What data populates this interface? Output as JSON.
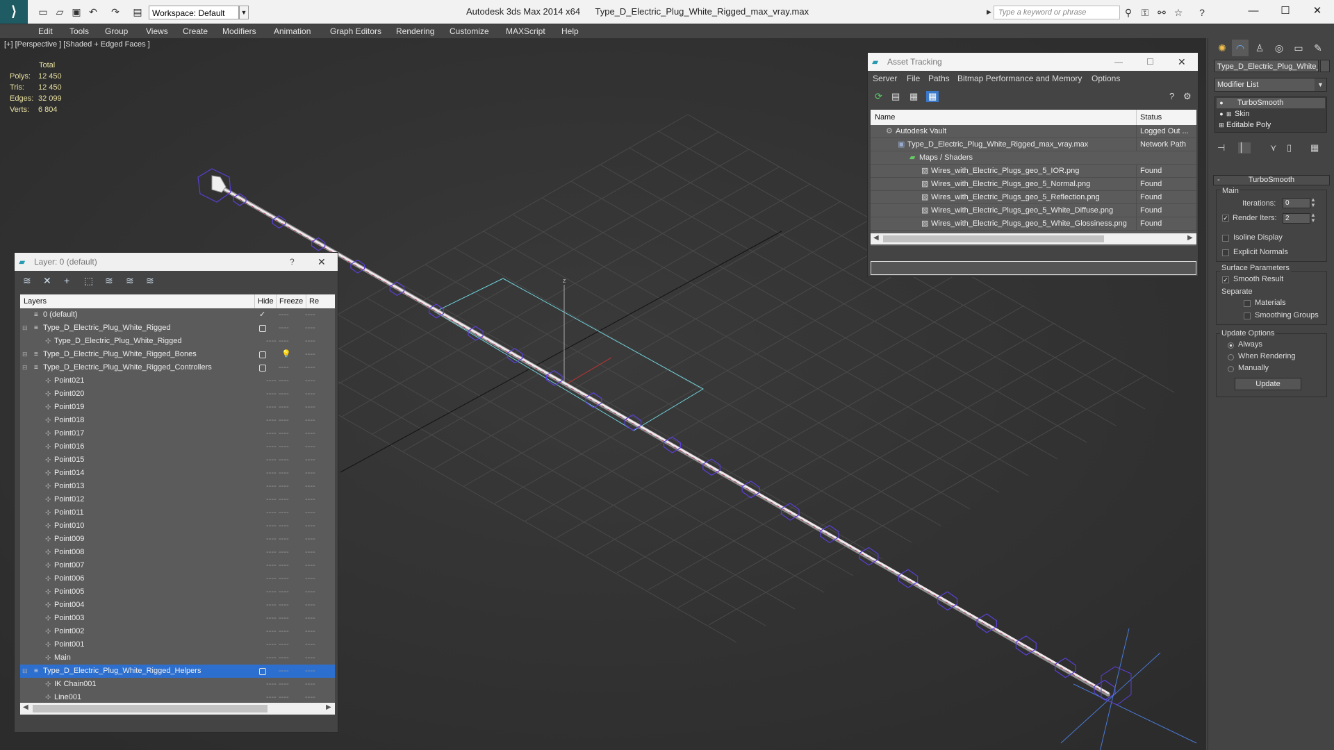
{
  "titlebar": {
    "workspace": "Workspace: Default",
    "app_name": "Autodesk 3ds Max  2014 x64",
    "file_name": "Type_D_Electric_Plug_White_Rigged_max_vray.max",
    "search_placeholder": "Type a keyword or phrase"
  },
  "menu": [
    "Edit",
    "Tools",
    "Group",
    "Views",
    "Create",
    "Modifiers",
    "Animation",
    "Graph Editors",
    "Rendering",
    "Customize",
    "MAXScript",
    "Help"
  ],
  "viewport": {
    "label": "[+] [Perspective ] [Shaded + Edged Faces ]",
    "stats": {
      "header": "Total",
      "rows": [
        {
          "label": "Polys:",
          "value": "12 450"
        },
        {
          "label": "Tris:",
          "value": "12 450"
        },
        {
          "label": "Edges:",
          "value": "32 099"
        },
        {
          "label": "Verts:",
          "value": "6 804"
        }
      ]
    },
    "axis_label": "z"
  },
  "layer_window": {
    "title": "Layer: 0 (default)",
    "help": "?",
    "columns": [
      "Layers",
      "Hide",
      "Freeze",
      "Re"
    ],
    "rows": [
      {
        "name": "0 (default)",
        "indent": 0,
        "kind": "layer",
        "current": true
      },
      {
        "name": "Type_D_Electric_Plug_White_Rigged",
        "indent": 0,
        "kind": "layer",
        "box": true
      },
      {
        "name": "Type_D_Electric_Plug_White_Rigged",
        "indent": 1,
        "kind": "object"
      },
      {
        "name": "Type_D_Electric_Plug_White_Rigged_Bones",
        "indent": 0,
        "kind": "layer",
        "box": true,
        "bulb": true
      },
      {
        "name": "Type_D_Electric_Plug_White_Rigged_Controllers",
        "indent": 0,
        "kind": "layer",
        "box": true
      },
      {
        "name": "Point021",
        "indent": 1,
        "kind": "object"
      },
      {
        "name": "Point020",
        "indent": 1,
        "kind": "object"
      },
      {
        "name": "Point019",
        "indent": 1,
        "kind": "object"
      },
      {
        "name": "Point018",
        "indent": 1,
        "kind": "object"
      },
      {
        "name": "Point017",
        "indent": 1,
        "kind": "object"
      },
      {
        "name": "Point016",
        "indent": 1,
        "kind": "object"
      },
      {
        "name": "Point015",
        "indent": 1,
        "kind": "object"
      },
      {
        "name": "Point014",
        "indent": 1,
        "kind": "object"
      },
      {
        "name": "Point013",
        "indent": 1,
        "kind": "object"
      },
      {
        "name": "Point012",
        "indent": 1,
        "kind": "object"
      },
      {
        "name": "Point011",
        "indent": 1,
        "kind": "object"
      },
      {
        "name": "Point010",
        "indent": 1,
        "kind": "object"
      },
      {
        "name": "Point009",
        "indent": 1,
        "kind": "object"
      },
      {
        "name": "Point008",
        "indent": 1,
        "kind": "object"
      },
      {
        "name": "Point007",
        "indent": 1,
        "kind": "object"
      },
      {
        "name": "Point006",
        "indent": 1,
        "kind": "object"
      },
      {
        "name": "Point005",
        "indent": 1,
        "kind": "object"
      },
      {
        "name": "Point004",
        "indent": 1,
        "kind": "object"
      },
      {
        "name": "Point003",
        "indent": 1,
        "kind": "object"
      },
      {
        "name": "Point002",
        "indent": 1,
        "kind": "object"
      },
      {
        "name": "Point001",
        "indent": 1,
        "kind": "object"
      },
      {
        "name": "Main",
        "indent": 1,
        "kind": "object"
      },
      {
        "name": "Type_D_Electric_Plug_White_Rigged_Helpers",
        "indent": 0,
        "kind": "layer",
        "box": true,
        "selected": true
      },
      {
        "name": "IK Chain001",
        "indent": 1,
        "kind": "object"
      },
      {
        "name": "Line001",
        "indent": 1,
        "kind": "object"
      }
    ],
    "dash": "----"
  },
  "asset_window": {
    "title": "Asset Tracking",
    "menu": [
      "Server",
      "File",
      "Paths",
      "Bitmap Performance and Memory",
      "Options"
    ],
    "columns": [
      "Name",
      "Status"
    ],
    "rows": [
      {
        "name": "Autodesk Vault",
        "status": "Logged Out ...",
        "indent": 0
      },
      {
        "name": "Type_D_Electric_Plug_White_Rigged_max_vray.max",
        "status": "Network Path",
        "indent": 1
      },
      {
        "name": "Maps / Shaders",
        "status": "",
        "indent": 2
      },
      {
        "name": "Wires_with_Electric_Plugs_geo_5_IOR.png",
        "status": "Found",
        "indent": 3
      },
      {
        "name": "Wires_with_Electric_Plugs_geo_5_Normal.png",
        "status": "Found",
        "indent": 3
      },
      {
        "name": "Wires_with_Electric_Plugs_geo_5_Reflection.png",
        "status": "Found",
        "indent": 3
      },
      {
        "name": "Wires_with_Electric_Plugs_geo_5_White_Diffuse.png",
        "status": "Found",
        "indent": 3
      },
      {
        "name": "Wires_with_Electric_Plugs_geo_5_White_Glossiness.png",
        "status": "Found",
        "indent": 3
      }
    ]
  },
  "command_panel": {
    "object_name": "Type_D_Electric_Plug_White_",
    "modifier_list": "Modifier List",
    "stack": [
      "TurboSmooth",
      "Skin",
      "Editable Poly"
    ],
    "turbosmooth": {
      "title": "TurboSmooth",
      "rollout_toggle": "-",
      "main": "Main",
      "iterations_label": "Iterations:",
      "iterations": "0",
      "render_iters_label": "Render Iters:",
      "render_iters": "2",
      "isoline": "Isoline Display",
      "explicit_normals": "Explicit Normals",
      "surface_params": "Surface Parameters",
      "smooth_result": "Smooth Result",
      "separate": "Separate",
      "materials": "Materials",
      "smoothing_groups": "Smoothing Groups",
      "update_options": "Update Options",
      "always": "Always",
      "when_rendering": "When Rendering",
      "manually": "Manually",
      "update_button": "Update"
    }
  },
  "colors": {
    "accent_selection": "#2d6fcf",
    "wire": "#5a3fd8",
    "stats_text": "#e8e0a0"
  }
}
